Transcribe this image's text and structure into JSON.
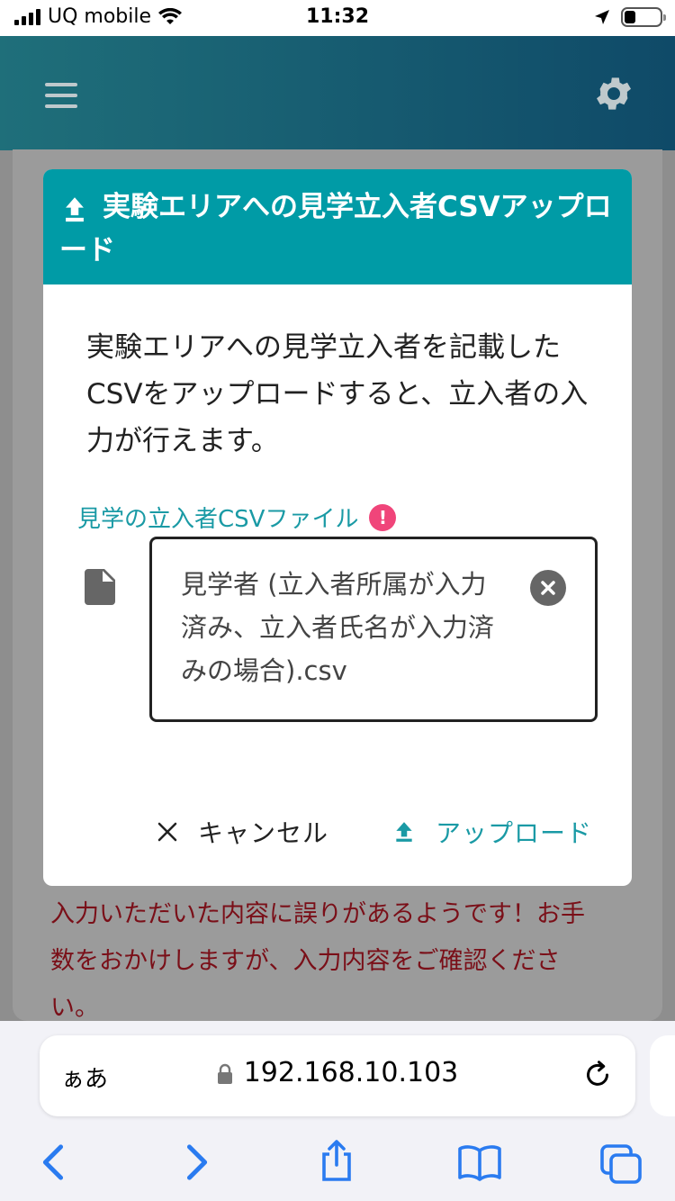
{
  "status_bar": {
    "carrier": "UQ mobile",
    "time": "11:32"
  },
  "app_header": {
    "menu_icon": "hamburger-icon",
    "settings_icon": "gear-icon"
  },
  "dialog": {
    "title": "実験エリアへの見学立入者CSVアップロード",
    "description": "実験エリアへの見学立入者を記載したCSVをアップロードすると、立入者の入力が行えます。",
    "field_label": "見学の立入者CSVファイル",
    "file_name": "見学者 (立入者所属が入力済み、立入者氏名が入力済みの場合).csv",
    "cancel_label": "キャンセル",
    "upload_label": "アップロード"
  },
  "background": {
    "error_message": "入力いただいた内容に誤りがあるようです！お手数をおかけしますが、入力内容をご確認ください。"
  },
  "browser": {
    "aa_label": "ぁあ",
    "url": "192.168.10.103"
  },
  "colors": {
    "accent": "#009ba6",
    "error": "#7a0f18",
    "required": "#f0457a"
  }
}
